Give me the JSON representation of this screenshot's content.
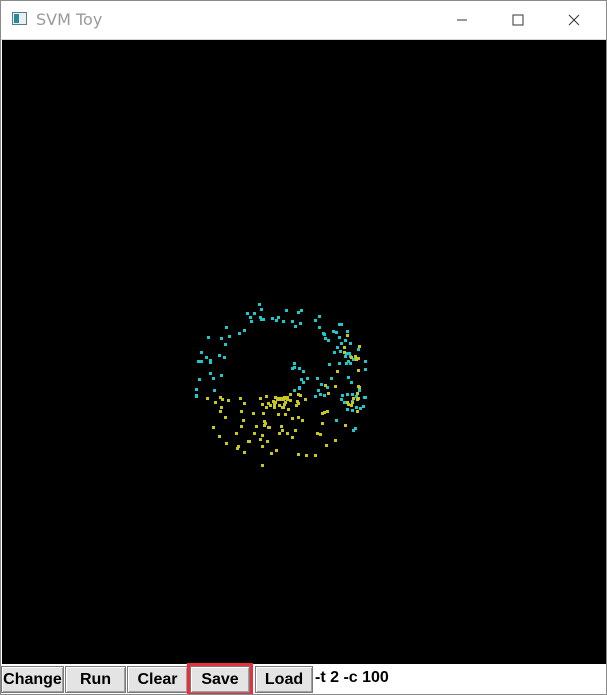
{
  "window": {
    "title": "SVM Toy",
    "controls": {
      "minimize_icon": "minimize-icon",
      "maximize_icon": "maximize-icon",
      "close_icon": "close-icon"
    }
  },
  "canvas": {
    "background": "#000000",
    "class_colors": {
      "cyan": "#1fc8c8",
      "yellow": "#c8c81a"
    }
  },
  "toolbar": {
    "change_label": "Change",
    "run_label": "Run",
    "clear_label": "Clear",
    "save_label": "Save",
    "load_label": "Load",
    "params_value": "-t 2 -c 100"
  },
  "highlight": {
    "target": "save-button",
    "color": "#e8303a"
  }
}
